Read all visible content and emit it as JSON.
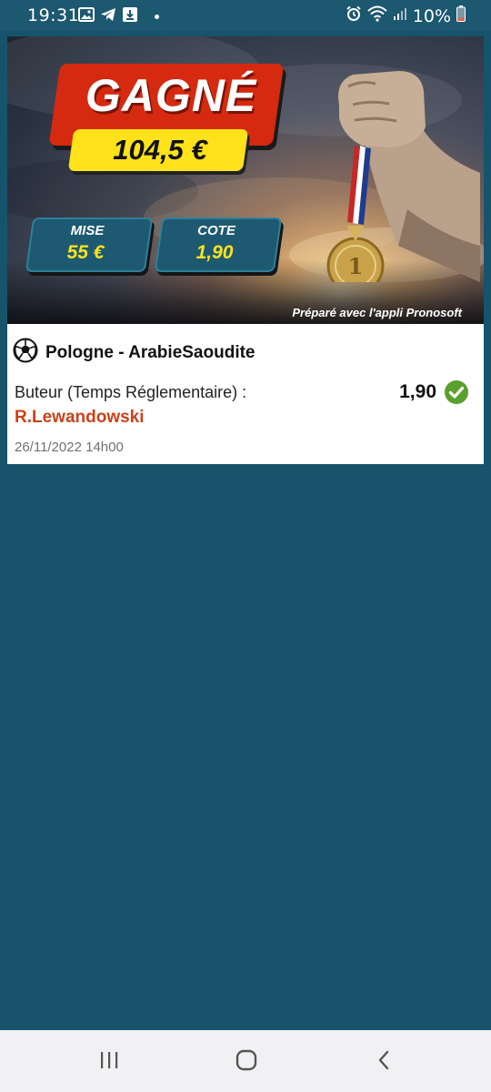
{
  "status_bar": {
    "time": "19:31",
    "battery": "10%",
    "left_icons": [
      "gallery-icon",
      "telegram-icon",
      "download-notification-icon",
      "dot-icon"
    ],
    "right_icons": [
      "alarm-icon",
      "wifi-icon",
      "signal-icon",
      "battery-icon"
    ],
    "battery_color": "#ff5a3c"
  },
  "banner": {
    "result": "GAGNÉ !",
    "gain": "104,5 €",
    "stake_label": "MISE",
    "stake_value": "55 €",
    "odds_label": "COTE",
    "odds_value": "1,90",
    "prepared_with": "Préparé avec l'appli Pronosoft",
    "accent_red": "#d52a10",
    "accent_yellow": "#ffe21a"
  },
  "bet": {
    "sport_icon": "soccer-ball-icon",
    "match": "Pologne - ArabieSaoudite",
    "market": "Buteur (Temps Réglementaire) :",
    "selection": "R.Lewandowski",
    "odds": "1,90",
    "status_icon": "check-circle-icon",
    "status_color": "#5aa02c",
    "date": "26/11/2022 14h00"
  },
  "nav_bar": {
    "buttons": [
      "recent-apps-icon",
      "home-icon",
      "back-icon"
    ]
  }
}
